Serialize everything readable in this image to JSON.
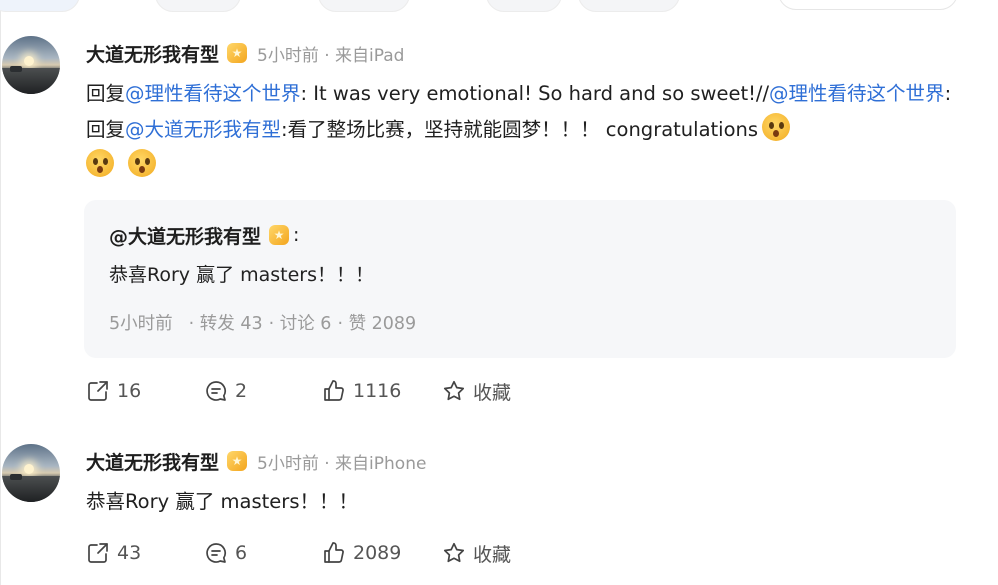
{
  "post1": {
    "username": "大道无形我有型",
    "meta": "5小时前 · 来自iPad",
    "body": {
      "prefix": "回复",
      "mention1": "@理性看待这个世界",
      "text1": ": It was very emotional! So hard and so sweet!//",
      "mention2": "@理性看待这个世界",
      "text2": ":回复",
      "mention3": "@大道无形我有型",
      "text3": ":看了整场比赛，坚持就能圆梦！！！ congratulations"
    },
    "quote": {
      "user": "@大道无形我有型",
      "colon": ":",
      "text": "恭喜Rory 赢了 masters！！！",
      "time": "5小时前",
      "reposts": "· 转发 43",
      "comments": "· 讨论 6",
      "likes": "· 赞 2089"
    },
    "actions": {
      "share": "16",
      "comment": "2",
      "like": "1116",
      "favorite": "收藏"
    }
  },
  "post2": {
    "username": "大道无形我有型",
    "meta": "5小时前 · 来自iPhone",
    "body": "恭喜Rory 赢了 masters！！！",
    "actions": {
      "share": "43",
      "comment": "6",
      "like": "2089",
      "favorite": "收藏"
    }
  },
  "icons": [
    "share-icon",
    "comment-icon",
    "like-icon",
    "star-icon",
    "vip-badge-icon",
    "surprised-emoji-icon"
  ],
  "colors": {
    "mention": "#2f6fd6",
    "meta": "#9a9a9a",
    "quote_bg": "#f6f7f9",
    "badge": "#f3a51e"
  }
}
